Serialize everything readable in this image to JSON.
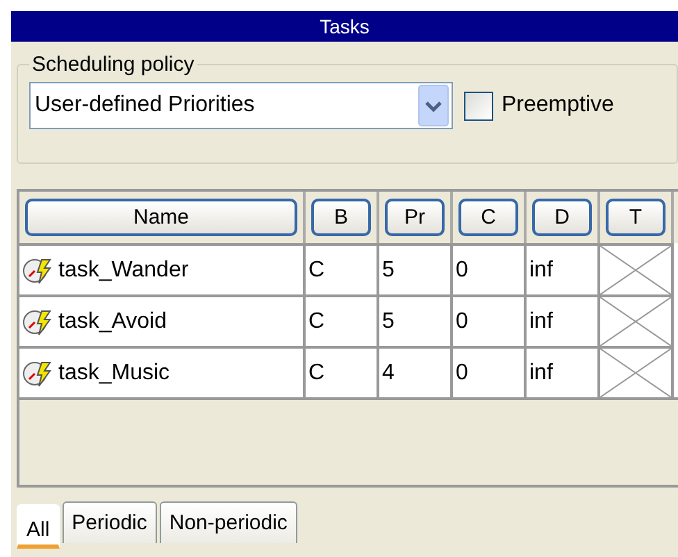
{
  "window": {
    "title": "Tasks"
  },
  "scheduling_policy": {
    "label": "Scheduling policy",
    "policy": "User-defined Priorities",
    "preemptive": {
      "label": "Preemptive",
      "checked": false
    }
  },
  "table": {
    "columns": [
      "Name",
      "B",
      "Pr",
      "C",
      "D",
      "T"
    ],
    "rows": [
      {
        "name": "task_Wander",
        "b": "C",
        "pr": "5",
        "c": "0",
        "d": "inf"
      },
      {
        "name": "task_Avoid",
        "b": "C",
        "pr": "5",
        "c": "0",
        "d": "inf"
      },
      {
        "name": "task_Music",
        "b": "C",
        "pr": "4",
        "c": "0",
        "d": "inf"
      }
    ]
  },
  "tabs": [
    {
      "label": "All",
      "selected": true
    },
    {
      "label": "Periodic",
      "selected": false
    },
    {
      "label": "Non-periodic",
      "selected": false
    }
  ]
}
